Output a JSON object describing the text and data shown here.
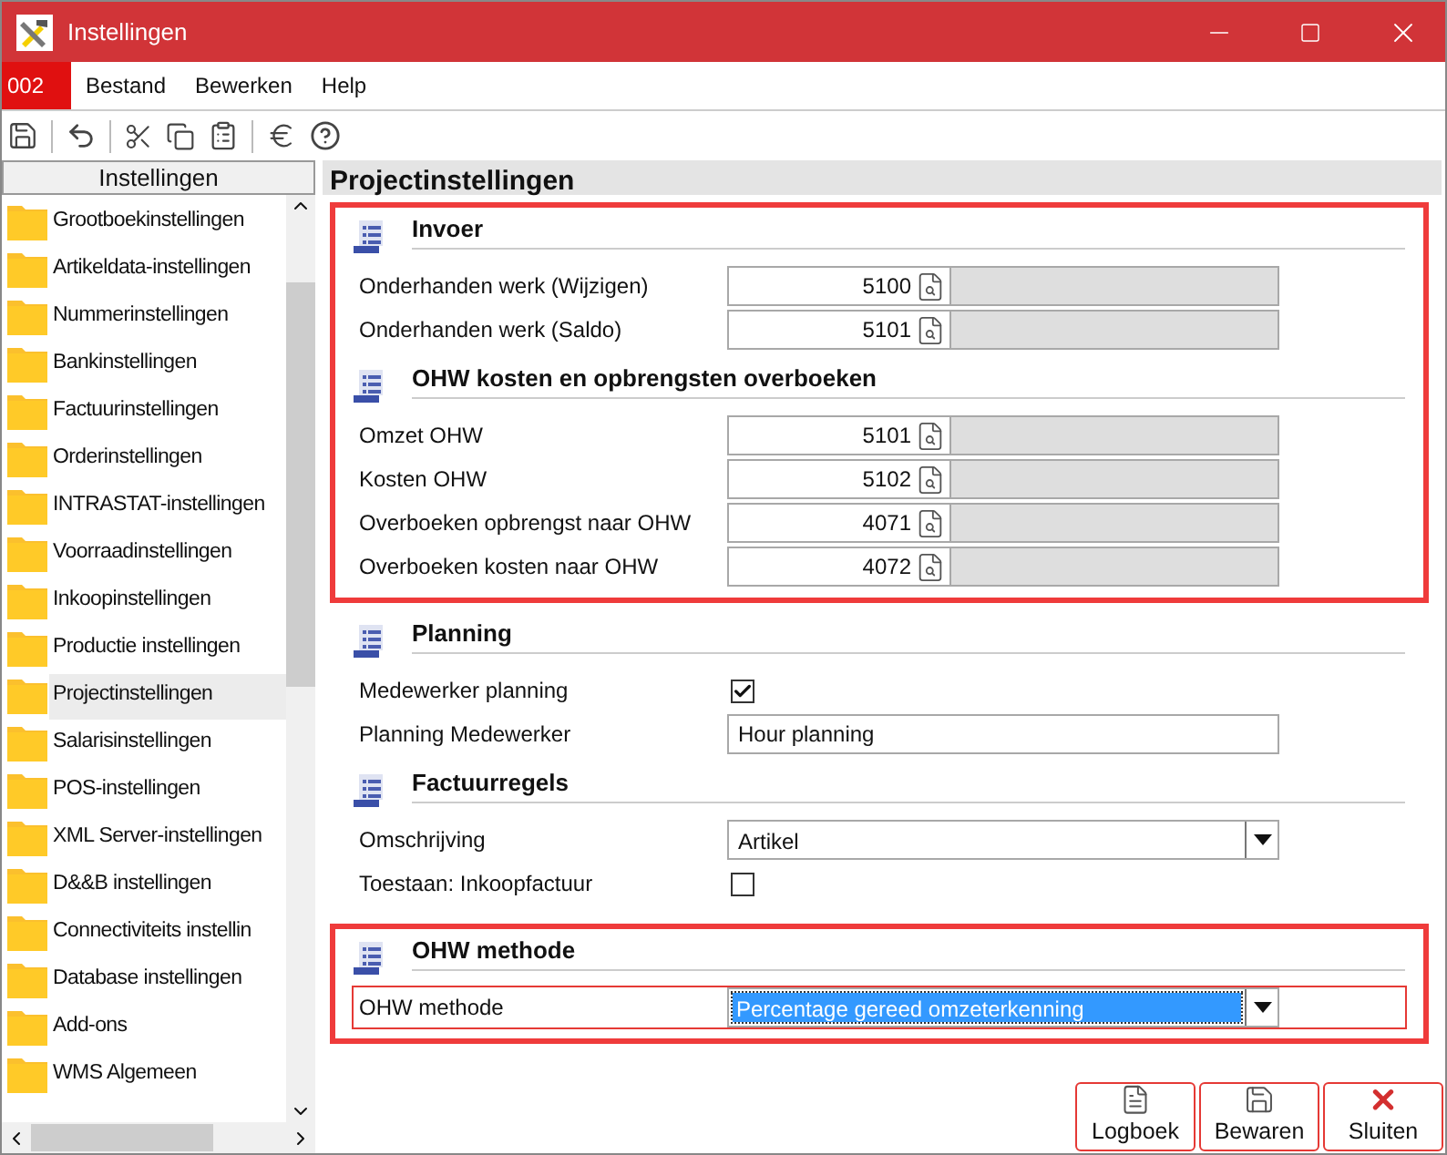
{
  "window": {
    "title": "Instellingen"
  },
  "menu": {
    "company": "002",
    "items": [
      "Bestand",
      "Bewerken",
      "Help"
    ]
  },
  "sidebar": {
    "header": "Instellingen",
    "items": [
      {
        "label": "Grootboekinstellingen",
        "selected": false
      },
      {
        "label": "Artikeldata-instellingen",
        "selected": false
      },
      {
        "label": "Nummerinstellingen",
        "selected": false
      },
      {
        "label": "Bankinstellingen",
        "selected": false
      },
      {
        "label": "Factuurinstellingen",
        "selected": false
      },
      {
        "label": "Orderinstellingen",
        "selected": false
      },
      {
        "label": "INTRASTAT-instellingen",
        "selected": false
      },
      {
        "label": "Voorraadinstellingen",
        "selected": false
      },
      {
        "label": "Inkoopinstellingen",
        "selected": false
      },
      {
        "label": "Productie instellingen",
        "selected": false
      },
      {
        "label": "Projectinstellingen",
        "selected": true
      },
      {
        "label": "Salarisinstellingen",
        "selected": false
      },
      {
        "label": "POS-instellingen",
        "selected": false
      },
      {
        "label": "XML Server-instellingen",
        "selected": false
      },
      {
        "label": "D&&B instellingen",
        "selected": false
      },
      {
        "label": "Connectiviteits instellin",
        "selected": false
      },
      {
        "label": "Database instellingen",
        "selected": false
      },
      {
        "label": "Add-ons",
        "selected": false
      },
      {
        "label": "WMS Algemeen",
        "selected": false
      }
    ]
  },
  "page": {
    "title": "Projectinstellingen",
    "groups": [
      {
        "highlighted": true,
        "sections": [
          {
            "title": "Invoer",
            "rows": [
              {
                "kind": "account",
                "label": "Onderhanden werk (Wijzigen)",
                "value": "5100"
              },
              {
                "kind": "account",
                "label": "Onderhanden werk (Saldo)",
                "value": "5101"
              }
            ]
          },
          {
            "title": "OHW kosten en opbrengsten overboeken",
            "rows": [
              {
                "kind": "account",
                "label": "Omzet OHW",
                "value": "5101"
              },
              {
                "kind": "account",
                "label": "Kosten OHW",
                "value": "5102"
              },
              {
                "kind": "account",
                "label": "Overboeken opbrengst naar OHW",
                "value": "4071"
              },
              {
                "kind": "account",
                "label": "Overboeken kosten naar OHW",
                "value": "4072"
              }
            ]
          }
        ]
      },
      {
        "highlighted": false,
        "sections": [
          {
            "title": "Planning",
            "rows": [
              {
                "kind": "checkbox",
                "label": "Medewerker planning",
                "checked": true
              },
              {
                "kind": "text",
                "label": "Planning Medewerker",
                "value": "Hour planning"
              }
            ]
          },
          {
            "title": "Factuurregels",
            "rows": [
              {
                "kind": "select",
                "label": "Omschrijving",
                "value": "Artikel",
                "focused": false
              },
              {
                "kind": "checkbox",
                "label": "Toestaan: Inkoopfactuur",
                "checked": false
              }
            ]
          }
        ]
      },
      {
        "highlighted": true,
        "sections": [
          {
            "title": "OHW methode",
            "rows": [
              {
                "kind": "select",
                "label": "OHW methode",
                "value": "Percentage gereed omzeterkenning",
                "focused": true
              }
            ]
          }
        ]
      }
    ]
  },
  "buttons": [
    {
      "kind": "log",
      "label": "Logboek"
    },
    {
      "kind": "save",
      "label": "Bewaren"
    },
    {
      "kind": "close",
      "label": "Sluiten"
    }
  ]
}
